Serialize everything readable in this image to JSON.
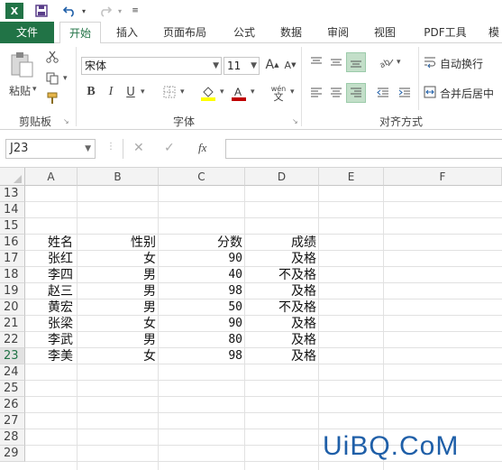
{
  "colors": {
    "accent": "#217346",
    "selection_highlight": "#c3dfc9",
    "watermark": "#1f5fa8"
  },
  "quick_access": {
    "app_icon": "excel-icon",
    "save_icon": "save-icon",
    "undo_icon": "undo-icon",
    "redo_icon": "redo-icon",
    "customize_icon": "customize-icon"
  },
  "tabs": [
    {
      "label": "文件"
    },
    {
      "label": "开始"
    },
    {
      "label": "插入"
    },
    {
      "label": "页面布局"
    },
    {
      "label": "公式"
    },
    {
      "label": "数据"
    },
    {
      "label": "审阅"
    },
    {
      "label": "视图"
    },
    {
      "label": "PDF工具"
    },
    {
      "label": "模"
    }
  ],
  "ribbon": {
    "clipboard": {
      "paste_label": "粘贴",
      "group_label": "剪贴板"
    },
    "font": {
      "font_name": "宋体",
      "font_size": "11",
      "bold": "B",
      "italic": "I",
      "underline": "U",
      "wen_label": "wén",
      "group_label": "字体"
    },
    "alignment": {
      "wrap_text": "自动换行",
      "merge_center": "合并后居中",
      "group_label": "对齐方式"
    }
  },
  "formula_bar": {
    "name_box": "J23",
    "fx_label": "fx",
    "formula": ""
  },
  "grid": {
    "columns": [
      "A",
      "B",
      "C",
      "D",
      "E",
      "F"
    ],
    "rows": [
      "13",
      "14",
      "15",
      "16",
      "17",
      "18",
      "19",
      "20",
      "21",
      "22",
      "23",
      "24",
      "25",
      "26",
      "27",
      "28",
      "29"
    ],
    "active_row": "23",
    "header": {
      "name": "姓名",
      "gender": "性别",
      "score": "分数",
      "grade": "成绩"
    },
    "records": [
      {
        "name": "张红",
        "gender": "女",
        "score": "90",
        "grade": "及格"
      },
      {
        "name": "李四",
        "gender": "男",
        "score": "40",
        "grade": "不及格"
      },
      {
        "name": "赵三",
        "gender": "男",
        "score": "98",
        "grade": "及格"
      },
      {
        "name": "黄宏",
        "gender": "男",
        "score": "50",
        "grade": "不及格"
      },
      {
        "name": "张梁",
        "gender": "女",
        "score": "90",
        "grade": "及格"
      },
      {
        "name": "李武",
        "gender": "男",
        "score": "80",
        "grade": "及格"
      },
      {
        "name": "李美",
        "gender": "女",
        "score": "98",
        "grade": "及格"
      }
    ]
  },
  "watermark": "UiBQ.CoM"
}
